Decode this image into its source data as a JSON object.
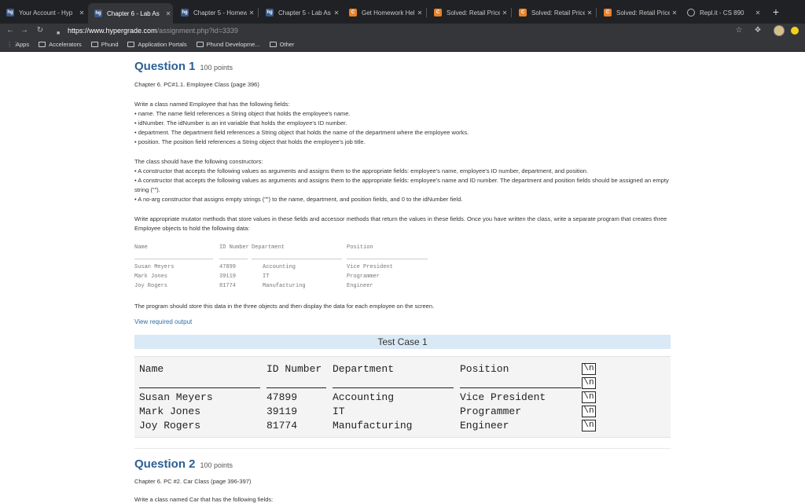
{
  "browser": {
    "tabs": [
      {
        "title": "Your Account - Hyp",
        "favicon": "hg"
      },
      {
        "title": "Chapter 6 - Lab As",
        "favicon": "hg",
        "active": true
      },
      {
        "title": "Chapter 5 - Homew",
        "favicon": "hg"
      },
      {
        "title": "Chapter 5 - Lab As",
        "favicon": "hg"
      },
      {
        "title": "Get Homework Help",
        "favicon": "chegg"
      },
      {
        "title": "Solved: Retail Price",
        "favicon": "chegg"
      },
      {
        "title": "Solved: Retail Price",
        "favicon": "chegg"
      },
      {
        "title": "Solved: Retail Price",
        "favicon": "chegg"
      },
      {
        "title": "Repl.it - CS 890",
        "favicon": "replit"
      }
    ],
    "url_host": "https://www.hypergrade.com",
    "url_path": "/assignment.php?id=3339",
    "bookmarks": [
      "Apps",
      "Accelerators",
      "Phund",
      "Application Portals",
      "Phund Developme...",
      "Other"
    ]
  },
  "question1": {
    "title": "Question 1",
    "points": "100 points",
    "subtitle": "Chapter 6. PC#1.1. Employee Class (page 396)",
    "intro": "Write a class named Employee that has the following fields:",
    "fields": [
      "• name. The name field references a String object that holds the employee's name.",
      "• idNumber. The idNumber is an int variable that holds the employee's ID number.",
      "• department. The department field references a String object that holds the name of the department where the employee works.",
      "• position. The position field references a String object that holds the employee's job title."
    ],
    "constructors_intro": "The class should have the following constructors:",
    "constructors": [
      "• A constructor that accepts the following values as arguments and assigns them to the appropriate fields: employee's name, employee's ID number, department, and position.",
      "• A constructor that accepts the following values as arguments and assigns them to the appropriate fields: employee's name and ID number. The department and position fields should be assigned an empty string (\"\").",
      "• A no-arg constructor that assigns empty strings (\"\") to the name, department, and position fields, and 0 to the idNumber field."
    ],
    "mutator_text": "Write appropriate mutator methods that store values in these fields and accessor methods that return the values in these fields. Once you have written the class, write a separate program that creates three Employee objects to hold the following data:",
    "data_table": {
      "headers": [
        "Name",
        "ID Number",
        "Department",
        "Position"
      ],
      "rows": [
        [
          "Susan Meyers",
          "47899",
          "Accounting",
          "Vice President"
        ],
        [
          "Mark Jones",
          "39119",
          "IT",
          "Programmer"
        ],
        [
          "Joy Rogers",
          "81774",
          "Manufacturing",
          "Engineer"
        ]
      ]
    },
    "closing": "The program should store this data in the three objects and then display the data for each employee on the screen.",
    "link": "View required output",
    "test_case": {
      "title": "Test Case 1",
      "headers": [
        "Name",
        "ID Number",
        "Department",
        "Position"
      ],
      "rows": [
        [
          "Susan Meyers",
          "47899",
          "Accounting",
          "Vice President"
        ],
        [
          "Mark Jones",
          "39119",
          "IT",
          "Programmer"
        ],
        [
          "Joy Rogers",
          "81774",
          "Manufacturing",
          "Engineer"
        ]
      ],
      "newline_marker": "\\n"
    }
  },
  "question2": {
    "title": "Question 2",
    "points": "100 points",
    "subtitle": "Chapter 6. PC #2. Car Class (page 396-397)",
    "intro": "Write a class named Car that has the following fields:"
  }
}
